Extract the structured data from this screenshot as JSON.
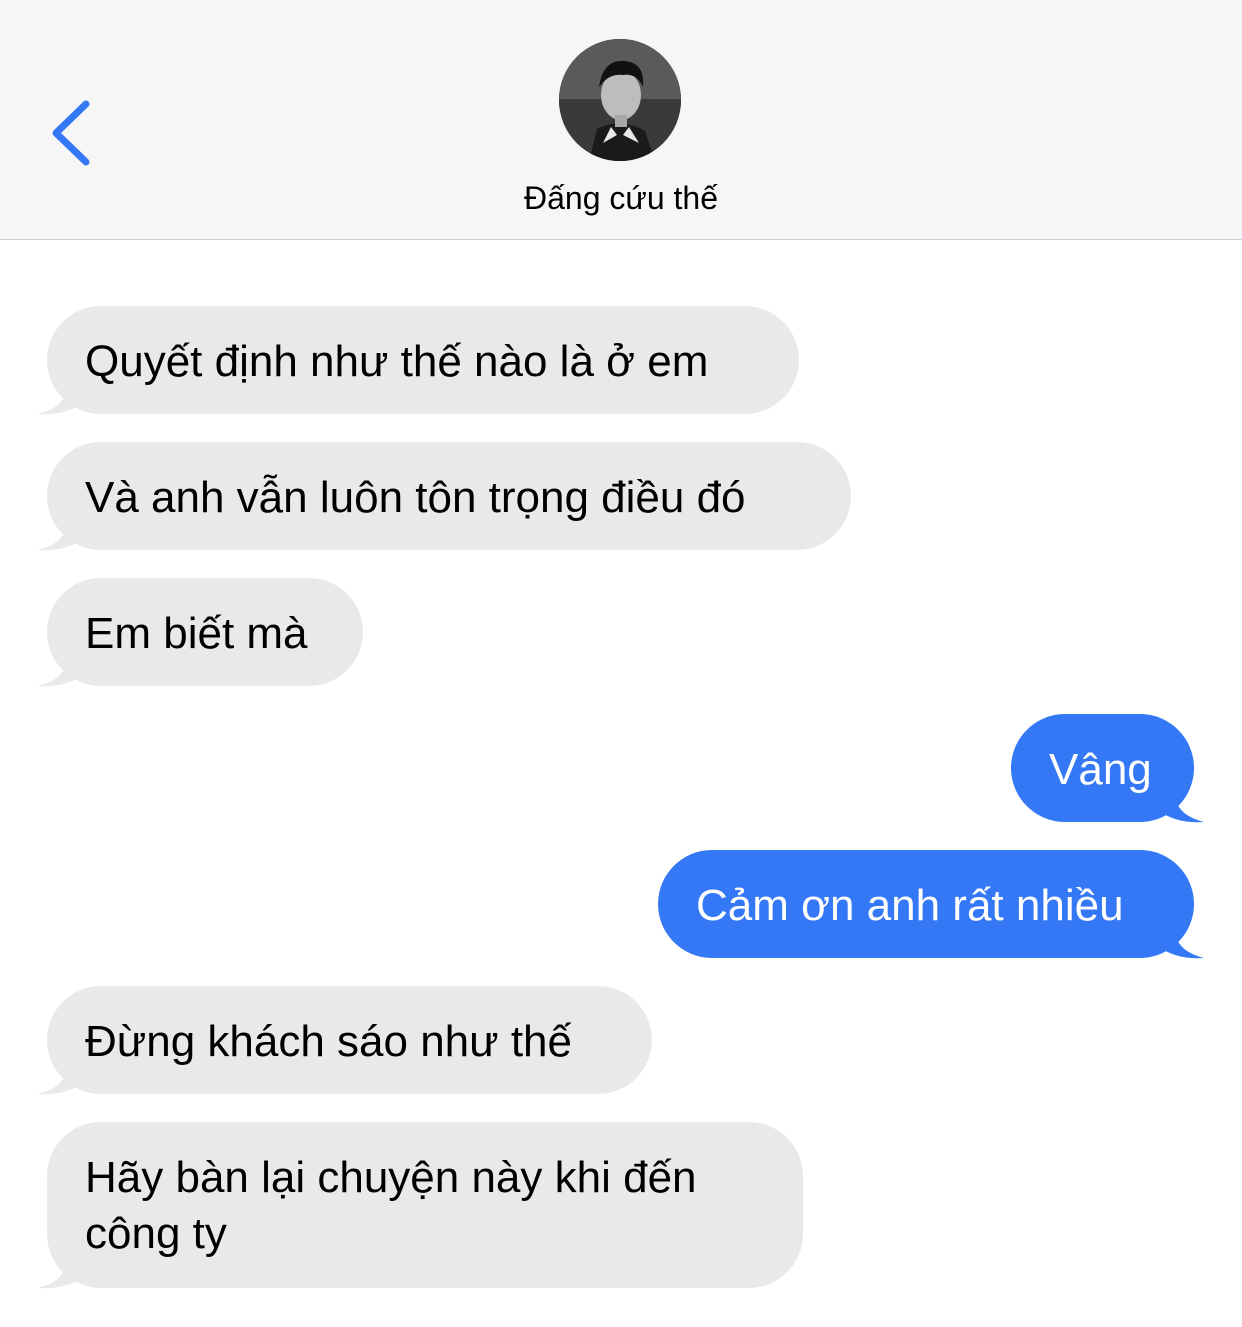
{
  "header": {
    "contact_name": "Đấng cứu thế",
    "back_icon": "chevron-left-icon",
    "accent_color": "#3478f6"
  },
  "messages": [
    {
      "direction": "incoming",
      "text": "Quyết định như thế nào là ở em"
    },
    {
      "direction": "incoming",
      "text": "Và anh vẫn luôn tôn trọng điều đó"
    },
    {
      "direction": "incoming",
      "text": "Em biết mà"
    },
    {
      "direction": "outgoing",
      "text": "Vâng"
    },
    {
      "direction": "outgoing",
      "text": "Cảm ơn anh rất nhiều"
    },
    {
      "direction": "incoming",
      "text": "Đừng khách sáo như thế"
    },
    {
      "direction": "incoming",
      "text_line1": "Hãy bàn lại chuyện này khi đến",
      "text_line2": "công ty"
    }
  ],
  "colors": {
    "incoming_bubble": "#e9e9eb",
    "outgoing_bubble": "#3478f6"
  }
}
